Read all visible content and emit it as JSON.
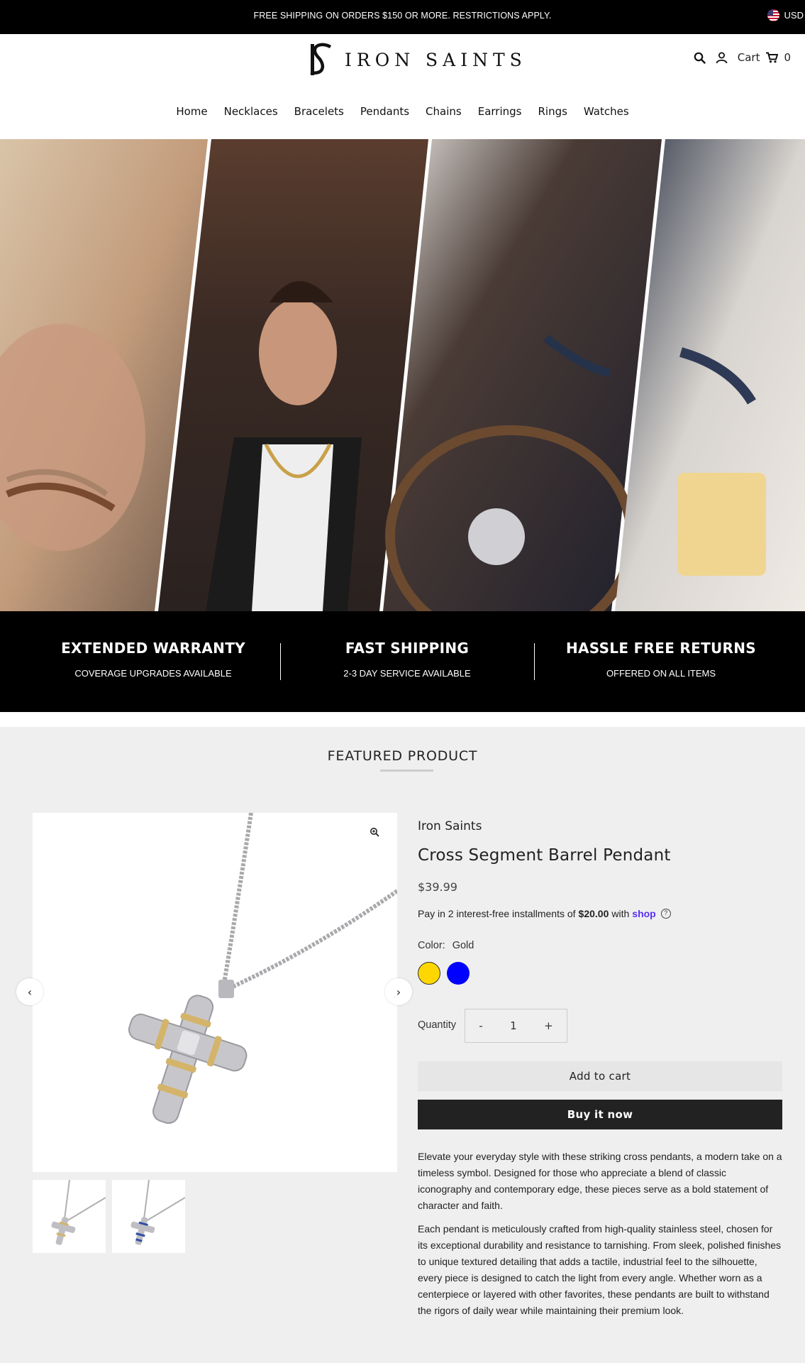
{
  "announcement": {
    "text": "FREE SHIPPING ON ORDERS $150 OR MORE. RESTRICTIONS APPLY.",
    "currency": "USD"
  },
  "header": {
    "logo_text": "IRON SAINTS",
    "cart_label": "Cart",
    "cart_count": "0",
    "icons": [
      "search-icon",
      "account-icon",
      "cart-icon"
    ]
  },
  "nav": {
    "items": [
      "Home",
      "Necklaces",
      "Bracelets",
      "Pendants",
      "Chains",
      "Earrings",
      "Rings",
      "Watches"
    ]
  },
  "trust": {
    "items": [
      {
        "title": "EXTENDED WARRANTY",
        "subtitle": "COVERAGE UPGRADES AVAILABLE"
      },
      {
        "title": "FAST SHIPPING",
        "subtitle": "2-3 DAY SERVICE AVAILABLE"
      },
      {
        "title": "HASSLE FREE RETURNS",
        "subtitle": "OFFERED ON ALL ITEMS"
      }
    ]
  },
  "featured": {
    "section_title": "FEATURED PRODUCT",
    "vendor": "Iron Saints",
    "title": "Cross Segment Barrel Pendant",
    "price": "$39.99",
    "shop_pay": {
      "prefix": "Pay in 2 interest-free installments of",
      "amount": "$20.00",
      "middle": "with",
      "brand": "shop",
      "brand_color": "#5a31f4"
    },
    "color_label": "Color:",
    "color_value": "Gold",
    "swatches": [
      {
        "name": "Gold",
        "hex": "#ffd700"
      },
      {
        "name": "Blue",
        "hex": "#0000ff"
      }
    ],
    "quantity_label": "Quantity",
    "quantity_minus": "-",
    "quantity_value": "1",
    "quantity_plus": "+",
    "add_to_cart": "Add to cart",
    "buy_now": "Buy it now",
    "description": [
      "Elevate your everyday style with these striking cross pendants, a modern take on a timeless symbol. Designed for those who appreciate a blend of classic iconography and contemporary edge, these pieces serve as a bold statement of character and faith.",
      "Each pendant is meticulously crafted from high-quality stainless steel, chosen for its exceptional durability and resistance to tarnishing. From sleek, polished finishes to unique textured detailing that adds a tactile, industrial feel to the silhouette, every piece is designed to catch the light from every angle. Whether worn as a centerpiece or layered with other favorites, these pendants are built to withstand the rigors of daily wear while maintaining their premium look."
    ],
    "prev_arrow": "‹",
    "next_arrow": "›"
  },
  "colors": {
    "announcement_bg": "#000000",
    "section_bg": "#efefef",
    "buy_button_bg": "#222222"
  }
}
